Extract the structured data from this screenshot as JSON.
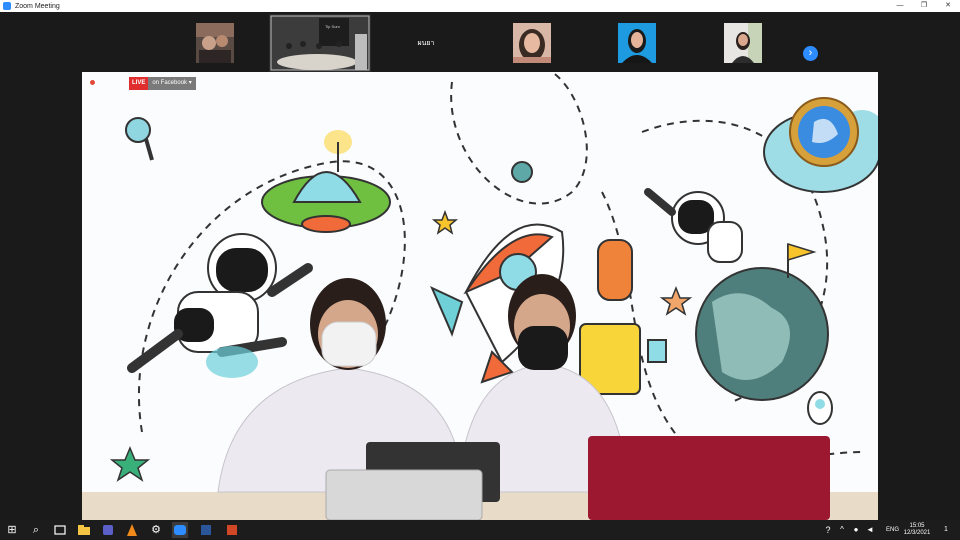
{
  "window": {
    "title": "Zoom Meeting",
    "controls": {
      "minimize": "—",
      "maximize": "❐",
      "close": "✕"
    }
  },
  "gallery": {
    "participants": [
      {
        "kind": "video"
      },
      {
        "kind": "video"
      },
      {
        "kind": "name",
        "name": "ผนยา"
      },
      {
        "kind": "video"
      },
      {
        "kind": "video"
      },
      {
        "kind": "video"
      }
    ],
    "next_symbol": "›"
  },
  "main": {
    "live_label": "LIVE",
    "live_target": "on Facebook",
    "live_caret": "▾"
  },
  "taskbar": {
    "start_symbol": "⊞",
    "search_symbol": "⌕",
    "apps": [
      "task-view",
      "file-explorer",
      "teams",
      "vlc",
      "settings",
      "zoom",
      "word",
      "powerpoint"
    ],
    "language": "ENG",
    "time": "15:05",
    "date": "12/3/2021",
    "notification_count": "1"
  },
  "colors": {
    "zoom_blue": "#2d8cff",
    "live_red": "#e02e2e",
    "fb_gray": "#7a7a7a",
    "background": "#1a1a1a",
    "laptop_red": "#9c1830",
    "shirt": "#eceaf0",
    "earth_green": "#4f7f7c",
    "cloud_cyan": "#9fdde6"
  }
}
